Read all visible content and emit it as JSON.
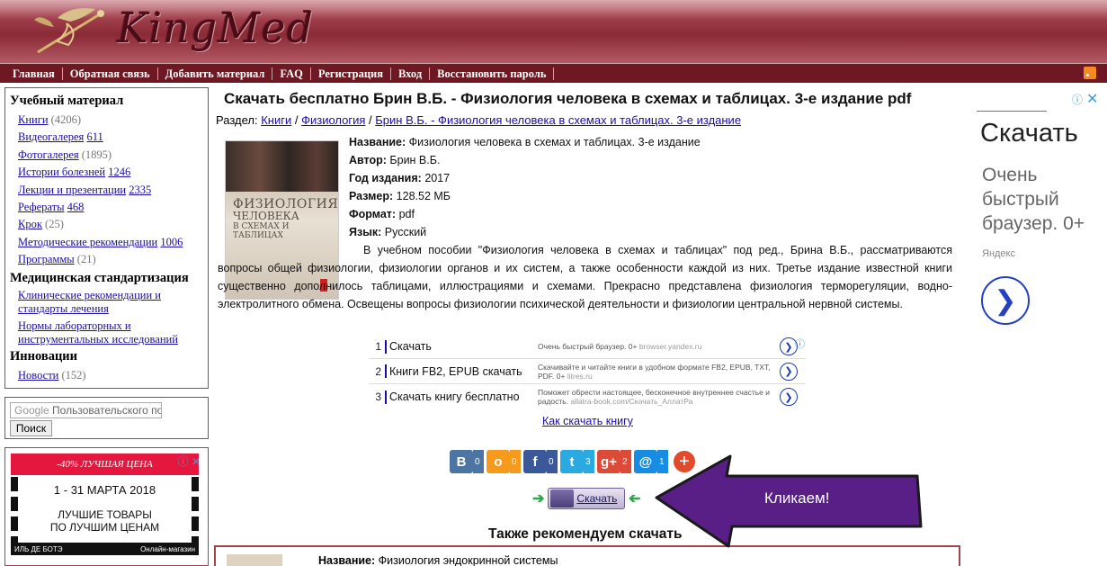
{
  "header": {
    "logo_text": "KingMed"
  },
  "nav": {
    "items": [
      "Главная",
      "Обратная связь",
      "Добавить материал",
      "FAQ",
      "Регистрация",
      "Вход",
      "Восстановить пароль"
    ]
  },
  "sidebar": {
    "section1": "Учебный материал",
    "items1": [
      {
        "label": "Книги",
        "count": "(4206)",
        "count_link": false
      },
      {
        "label": "Видеогалерея",
        "count": "611",
        "count_link": true
      },
      {
        "label": "Фотогалерея",
        "count": "(1895)",
        "count_link": false
      },
      {
        "label": "Истории болезней",
        "count": "1246",
        "count_link": true
      },
      {
        "label": "Лекции и презентации",
        "count": "2335",
        "count_link": true
      },
      {
        "label": "Рефераты",
        "count": "468",
        "count_link": true
      },
      {
        "label": "Крок",
        "count": "(25)",
        "count_link": false
      },
      {
        "label": "Методические рекомендации",
        "count": "1006",
        "count_link": true
      },
      {
        "label": "Программы",
        "count": "(21)",
        "count_link": false
      }
    ],
    "section2": "Медицинская стандартизация",
    "items2": [
      "Клинические рекомендации и стандарты лечения",
      "Нормы лабораторных и инструментальных исследований"
    ],
    "section3": "Инновации",
    "items3": [
      {
        "label": "Новости",
        "count": "(152)"
      }
    ]
  },
  "search": {
    "google": "Google",
    "placeholder": "Пользовательского по",
    "button": "Поиск"
  },
  "side_ad": {
    "top": "-40% ЛУЧШАЯ ЦЕНА",
    "dates": "1 - 31 МАРТА 2018",
    "line1": "ЛУЧШИЕ ТОВАРЫ",
    "line2": "ПО ЛУЧШИМ ЦЕНАМ",
    "brand": "ИЛЬ ДЕ БОТЭ",
    "brand_sub": "Онлайн-магазин",
    "info": "ⓘ ✕"
  },
  "main": {
    "title": "Скачать бесплатно Брин В.Б. - Физиология человека в схемах и таблицах. 3-е издание pdf",
    "breadcrumb_prefix": "Раздел:",
    "breadcrumb": [
      "Книги",
      "Физиология",
      "Брин В.Б. - Физиология человека в схемах и таблицах. 3-е издание"
    ],
    "cover": {
      "t1": "ФИЗИОЛОГИЯ",
      "t2": "ЧЕЛОВЕКА",
      "t3": "В СХЕМАХ И ТАБЛИЦАХ",
      "author": "В. Б. БРИН"
    },
    "fields": [
      {
        "label": "Название:",
        "value": "Физиология человека в схемах и таблицах. 3-е издание"
      },
      {
        "label": "Автор:",
        "value": "Брин В.Б."
      },
      {
        "label": "Год издания:",
        "value": "2017"
      },
      {
        "label": "Размер:",
        "value": "128.52 МБ"
      },
      {
        "label": "Формат:",
        "value": "pdf"
      },
      {
        "label": "Язык:",
        "value": "Русский"
      }
    ],
    "description": "В учебном пособии \"Физиология человека в схемах и таблицах\" под ред., Брина В.Б., рассматриваются вопросы общей физиологии, физиологии органов и их систем, а также особенности каждой из них. Третье издание известной книги существенно дополнилось таблицами, иллюстрациями и схемами. Прекрасно представлена физиология терморегуляции, водно-электролитного обмена. Освещены вопросы физиологии психической деятельности и физиологии центральной нервной системы.",
    "ads": [
      {
        "num": "1",
        "label": "Скачать",
        "sub": "Очень быстрый браузер. 0+",
        "domain": "browser.yandex.ru"
      },
      {
        "num": "2",
        "label": "Книги FB2, EPUB скачать",
        "sub": "Скачивайте и читайте книги в удобном формате FB2, EPUB, TXT, PDF. 0+",
        "domain": "litres.ru"
      },
      {
        "num": "3",
        "label": "Скачать книгу бесплатно",
        "sub": "Поможет обрести настоящее, бесконечное внутреннее счастье и радость.",
        "domain": "allatra-book.com/Скачать_АллатРа"
      }
    ],
    "how_link": "Как скачать книгу",
    "share": [
      {
        "icon": "В",
        "count": "0",
        "color": "#4c75a3"
      },
      {
        "icon": "о",
        "count": "0",
        "color": "#f59a1d"
      },
      {
        "icon": "f",
        "count": "0",
        "color": "#3b5998"
      },
      {
        "icon": "t",
        "count": "3",
        "color": "#2ba9e1"
      },
      {
        "icon": "g+",
        "count": "2",
        "color": "#dc4a38"
      },
      {
        "icon": "@",
        "count": "1",
        "color": "#168de2"
      }
    ],
    "download_label": "Скачать",
    "recommend_title": "Также рекомендуем скачать",
    "rec_label": "Название:",
    "rec_value": "Физиология эндокринной системы"
  },
  "right_ad": {
    "title": "Скачать",
    "sub": "Очень быстрый браузер. 0+",
    "source": "Яндекс",
    "info": "ⓘ",
    "close": "✕"
  },
  "callout": {
    "text": "Кликаем!"
  },
  "colors": {
    "brand": "#8a2a36",
    "nav": "#6e1823",
    "callout": "#5a1f87"
  }
}
